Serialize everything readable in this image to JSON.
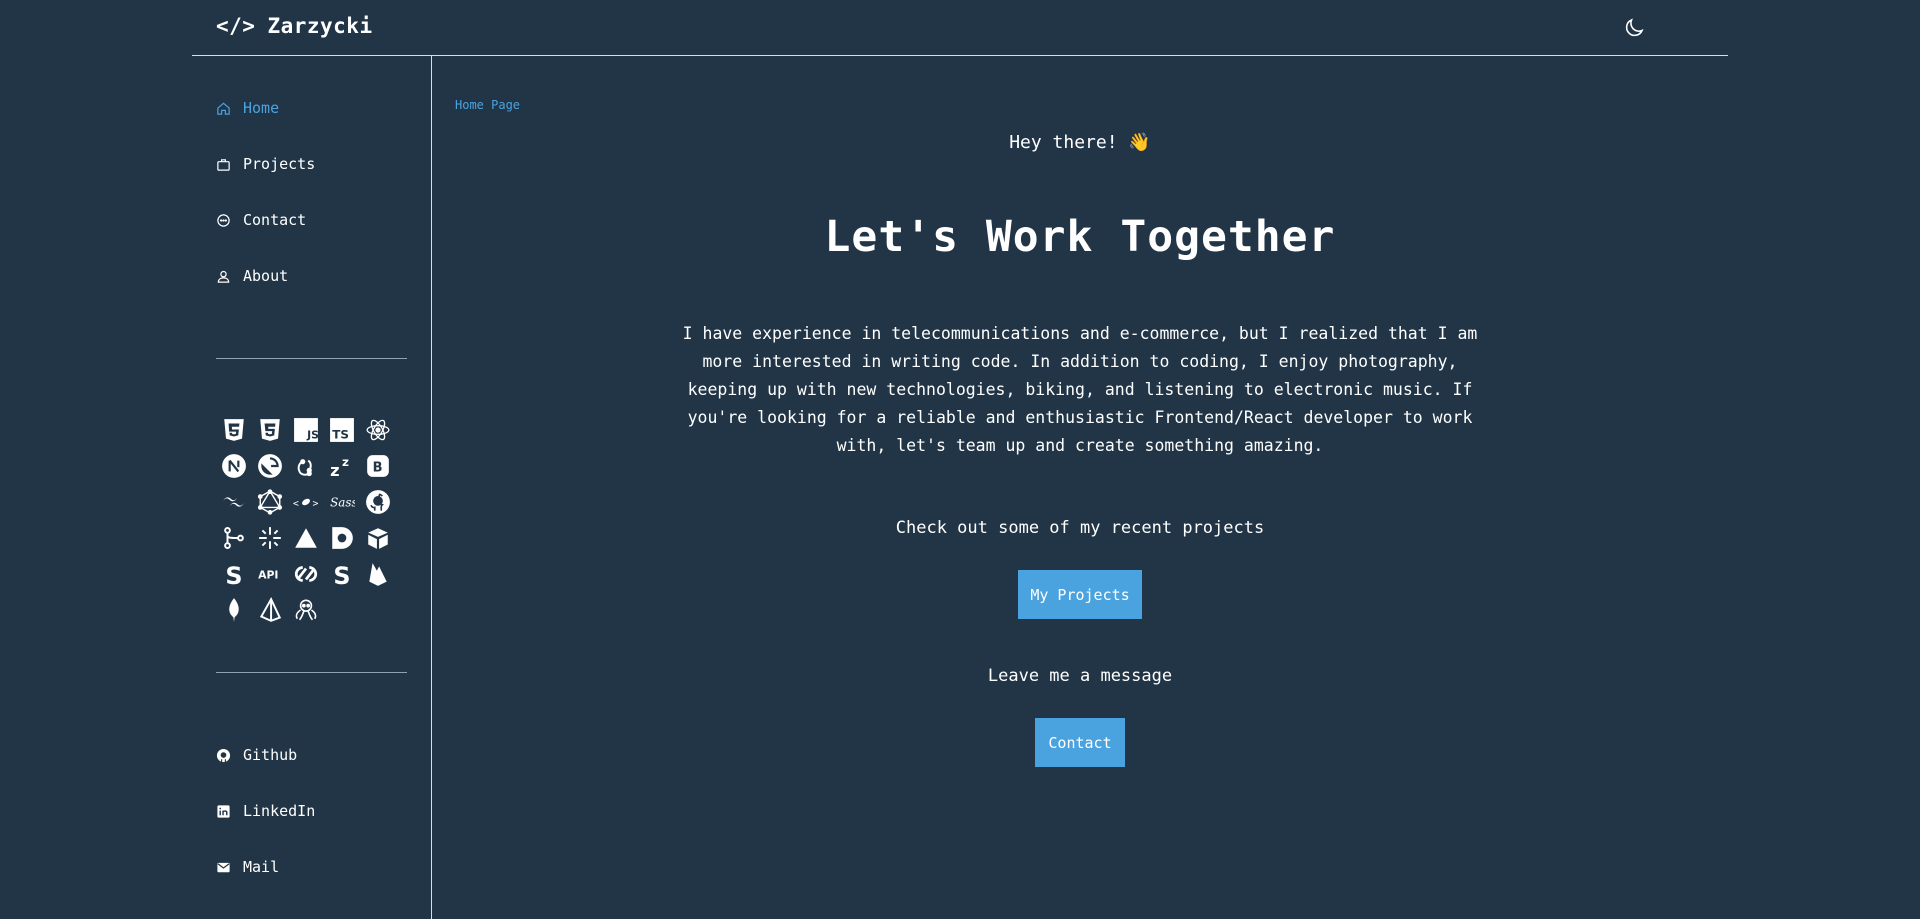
{
  "header": {
    "logo_mark": "</>",
    "site_name": "Zarzycki",
    "theme_toggle_icon": "moon-icon"
  },
  "sidebar": {
    "nav": [
      {
        "label": "Home",
        "icon": "home-icon",
        "active": true
      },
      {
        "label": "Projects",
        "icon": "briefcase-icon",
        "active": false
      },
      {
        "label": "Contact",
        "icon": "chat-icon",
        "active": false
      },
      {
        "label": "About",
        "icon": "user-icon",
        "active": false
      }
    ],
    "tech_icons": [
      "html5-icon",
      "css3-icon",
      "javascript-icon",
      "typescript-icon",
      "react-icon",
      "nextjs-icon",
      "gatsby-icon",
      "redux-icon",
      "zustand-icon",
      "bootstrap-icon",
      "tailwind-icon",
      "graphql-icon",
      "styled-components-icon",
      "sass-icon",
      "github-icon",
      "git-icon",
      "jest-icon",
      "vercel-icon",
      "dato-cms-icon",
      "strapi-icon",
      "stripe-icon",
      "api-icon",
      "contentful-icon",
      "sanity-icon",
      "firebase-icon",
      "mongodb-icon",
      "prisma-icon",
      "octopus-icon"
    ],
    "social": [
      {
        "label": "Github",
        "icon": "github-icon"
      },
      {
        "label": "LinkedIn",
        "icon": "linkedin-icon"
      },
      {
        "label": "Mail",
        "icon": "mail-icon"
      }
    ]
  },
  "main": {
    "breadcrumb": "Home Page",
    "greeting": "Hey there! 👋",
    "headline": "Let's Work Together",
    "intro": "I have experience in telecommunications and e-commerce, but I realized that I am more interested in writing code. In addition to coding, I enjoy photography, keeping up with new technologies, biking, and listening to electronic music. If you're looking for a reliable and enthusiastic Frontend/React developer to work with, let's team up and create something amazing.",
    "projects_prompt": "Check out some of my recent projects",
    "projects_button": "My Projects",
    "message_prompt": "Leave me a message",
    "contact_button": "Contact"
  },
  "colors": {
    "background": "#213547",
    "accent": "#4aa3df",
    "text": "#ffffff",
    "divider": "#8fa1b3"
  }
}
